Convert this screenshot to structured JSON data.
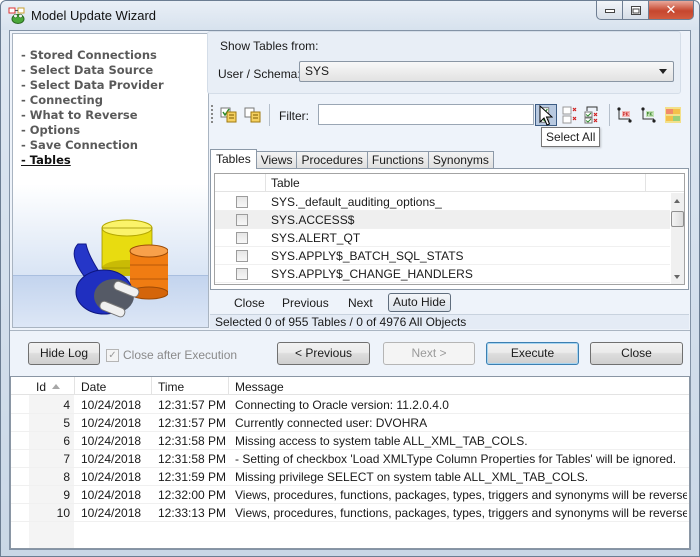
{
  "window": {
    "title": "Model Update Wizard",
    "icon": "frog-model-icon",
    "controls": {
      "minimize": "minimize-icon",
      "maximize": "maximize-icon",
      "close": "close-icon"
    }
  },
  "sidebar": {
    "items": [
      {
        "label": "- Stored Connections",
        "active": false
      },
      {
        "label": "- Select Data Source",
        "active": false
      },
      {
        "label": "- Select Data Provider",
        "active": false
      },
      {
        "label": "- Connecting",
        "active": false
      },
      {
        "label": "- What to Reverse",
        "active": false
      },
      {
        "label": "- Options",
        "active": false
      },
      {
        "label": "- Save Connection",
        "active": false
      },
      {
        "label": "- Tables",
        "active": true
      }
    ],
    "illustration": "database-plug-illustration"
  },
  "show_tables": {
    "group_label": "Show Tables from:",
    "schema_label": "User / Schema:",
    "schema_value": "SYS"
  },
  "toolbar": {
    "filter_label": "Filter:",
    "filter_value": "",
    "icons": [
      "check-list-icon",
      "uncheck-list-icon",
      "select-all-icon",
      "deselect-all-icon",
      "invert-selection-icon",
      "select-pk-icon",
      "select-fk-icon",
      "select-pk-fk-icon"
    ],
    "tooltip": "Select All"
  },
  "tabs": [
    {
      "label": "Tables",
      "active": true
    },
    {
      "label": "Views",
      "active": false
    },
    {
      "label": "Procedures",
      "active": false
    },
    {
      "label": "Functions",
      "active": false
    },
    {
      "label": "Synonyms",
      "active": false
    }
  ],
  "table_grid": {
    "column_header": "Table",
    "rows": [
      {
        "name": "SYS._default_auditing_options_",
        "checked": false
      },
      {
        "name": "SYS.ACCESS$",
        "checked": false
      },
      {
        "name": "SYS.ALERT_QT",
        "checked": false
      },
      {
        "name": "SYS.APPLY$_BATCH_SQL_STATS",
        "checked": false
      },
      {
        "name": "SYS.APPLY$_CHANGE_HANDLERS",
        "checked": false
      }
    ]
  },
  "search_nav": {
    "close": "Close",
    "previous": "Previous",
    "next": "Next",
    "auto_hide": "Auto Hide"
  },
  "status": "Selected 0 of 955 Tables / 0 of 4976 All Objects",
  "buttons": {
    "hide_log": "Hide Log",
    "close_after_execution": "Close after Execution",
    "close_after_execution_checked": true,
    "previous": "< Previous",
    "next": "Next >",
    "execute": "Execute",
    "close": "Close"
  },
  "log": {
    "headers": {
      "id": "Id",
      "date": "Date",
      "time": "Time",
      "message": "Message"
    },
    "rows": [
      {
        "id": "4",
        "date": "10/24/2018",
        "time": "12:31:57 PM",
        "message": "Connecting to Oracle version: 11.2.0.4.0"
      },
      {
        "id": "5",
        "date": "10/24/2018",
        "time": "12:31:57 PM",
        "message": "Currently connected user: DVOHRA"
      },
      {
        "id": "6",
        "date": "10/24/2018",
        "time": "12:31:58 PM",
        "message": "Missing access to system table ALL_XML_TAB_COLS."
      },
      {
        "id": "7",
        "date": "10/24/2018",
        "time": "12:31:58 PM",
        "message": " - Setting of checkbox 'Load XMLType Column Properties for Tables' will be ignored."
      },
      {
        "id": "8",
        "date": "10/24/2018",
        "time": "12:31:59 PM",
        "message": "Missing privilege SELECT on system table ALL_XML_TAB_COLS."
      },
      {
        "id": "9",
        "date": "10/24/2018",
        "time": "12:32:00 PM",
        "message": "Views, procedures, functions, packages, types, triggers and synonyms will be reversed from e..."
      },
      {
        "id": "10",
        "date": "10/24/2018",
        "time": "12:33:13 PM",
        "message": "Views, procedures, functions, packages, types, triggers and synonyms will be reversed from e..."
      }
    ]
  }
}
